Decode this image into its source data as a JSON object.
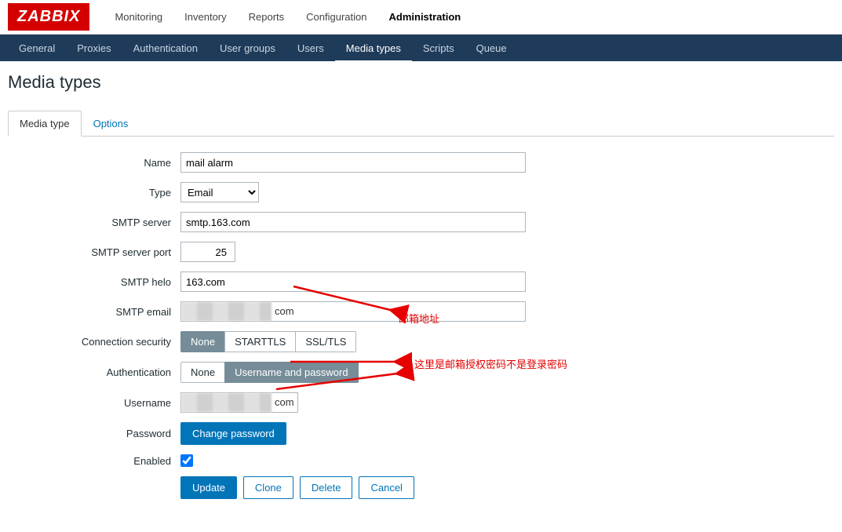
{
  "logo": "ZABBIX",
  "topnav": {
    "items": [
      {
        "label": "Monitoring"
      },
      {
        "label": "Inventory"
      },
      {
        "label": "Reports"
      },
      {
        "label": "Configuration"
      },
      {
        "label": "Administration",
        "active": true
      }
    ]
  },
  "subnav": {
    "items": [
      {
        "label": "General"
      },
      {
        "label": "Proxies"
      },
      {
        "label": "Authentication"
      },
      {
        "label": "User groups"
      },
      {
        "label": "Users"
      },
      {
        "label": "Media types",
        "active": true
      },
      {
        "label": "Scripts"
      },
      {
        "label": "Queue"
      }
    ]
  },
  "page_title": "Media types",
  "tabs": [
    {
      "label": "Media type",
      "active": true
    },
    {
      "label": "Options"
    }
  ],
  "form": {
    "name": {
      "label": "Name",
      "value": "mail alarm"
    },
    "type": {
      "label": "Type",
      "value": "Email"
    },
    "smtp_server": {
      "label": "SMTP server",
      "value": "smtp.163.com"
    },
    "smtp_port": {
      "label": "SMTP server port",
      "value": "25"
    },
    "smtp_helo": {
      "label": "SMTP helo",
      "value": "163.com"
    },
    "smtp_email": {
      "label": "SMTP email",
      "value": "",
      "suffix": "com"
    },
    "conn_sec": {
      "label": "Connection security",
      "options": [
        "None",
        "STARTTLS",
        "SSL/TLS"
      ],
      "selected": 0
    },
    "auth": {
      "label": "Authentication",
      "options": [
        "None",
        "Username and password"
      ],
      "selected": 1
    },
    "username": {
      "label": "Username",
      "value": "",
      "suffix": "com"
    },
    "password": {
      "label": "Password",
      "button": "Change password"
    },
    "enabled": {
      "label": "Enabled",
      "checked": true
    }
  },
  "actions": {
    "update": "Update",
    "clone": "Clone",
    "delete": "Delete",
    "cancel": "Cancel"
  },
  "annotations": {
    "email": "邮箱地址",
    "password": "这里是邮箱授权密码不是登录密码"
  }
}
